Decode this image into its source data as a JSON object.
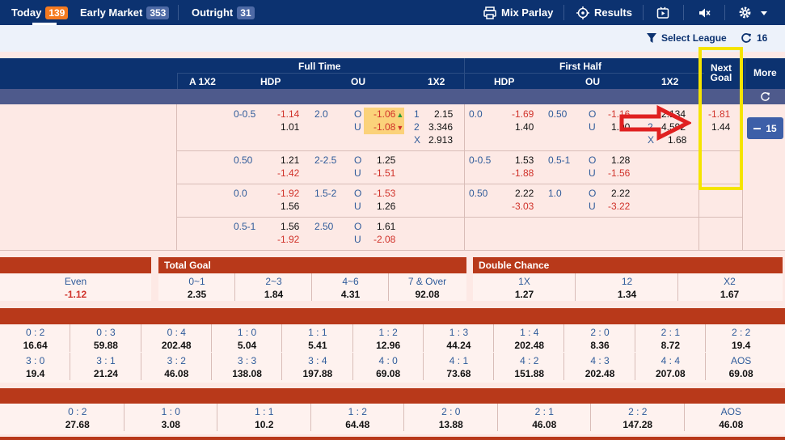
{
  "topnav": {
    "today": {
      "label": "Today",
      "count": "139"
    },
    "early": {
      "label": "Early Market",
      "count": "353"
    },
    "outright": {
      "label": "Outright",
      "count": "31"
    },
    "mix_parlay": "Mix Parlay",
    "results": "Results"
  },
  "subbar": {
    "select_league": "Select League",
    "refresh_count": "16"
  },
  "header": {
    "full_time": "Full Time",
    "first_half": "First Half",
    "next_goal": "Next Goal",
    "more": "More",
    "cols": {
      "a1x2": "A 1X2",
      "hdp": "HDP",
      "ou": "OU",
      "x12": "1X2",
      "hdp2": "HDP",
      "ou2": "OU",
      "x12b": "1X2"
    }
  },
  "more_count": "15",
  "rows": [
    {
      "ft_hdp_line": "0-0.5",
      "ft_hdp_a": "-1.14",
      "ft_hdp_b": "1.01",
      "ft_ou_line": "2.0",
      "ft_o": "O",
      "ft_o_v": "-1.06",
      "ft_u": "U",
      "ft_u_v": "-1.08",
      "x1": "1",
      "x1v": "2.15",
      "x2": "2",
      "x2v": "3.346",
      "xx": "X",
      "xxv": "2.913",
      "fh_hdp_line": "0.0",
      "fh_hdp_a": "-1.69",
      "fh_hdp_b": "1.40",
      "fh_ou_line": "0.50",
      "fh_o": "O",
      "fh_o_v": "-1.16",
      "fh_u": "U",
      "fh_u_v": "1.00",
      "fh1v": "2.134",
      "fh2": "2",
      "fh2v": "4.592",
      "fhx": "X",
      "fhxv": "1.68",
      "ng_a": "-1.81",
      "ng_b": "1.44"
    },
    {
      "ft_hdp_line": "0.50",
      "ft_hdp_a": "1.21",
      "ft_hdp_b": "-1.42",
      "ft_ou_line": "2-2.5",
      "ft_o": "O",
      "ft_o_v": "1.25",
      "ft_u": "U",
      "ft_u_v": "-1.51",
      "fh_hdp_line": "0-0.5",
      "fh_hdp_a": "1.53",
      "fh_hdp_b": "-1.88",
      "fh_ou_line": "0.5-1",
      "fh_o": "O",
      "fh_o_v": "1.28",
      "fh_u": "U",
      "fh_u_v": "-1.56"
    },
    {
      "ft_hdp_line": "0.0",
      "ft_hdp_a": "-1.92",
      "ft_hdp_b": "1.56",
      "ft_ou_line": "1.5-2",
      "ft_o": "O",
      "ft_o_v": "-1.53",
      "ft_u": "U",
      "ft_u_v": "1.26",
      "fh_hdp_line": "0.50",
      "fh_hdp_a": "2.22",
      "fh_hdp_b": "-3.03",
      "fh_ou_line": "1.0",
      "fh_o": "O",
      "fh_o_v": "2.22",
      "fh_u": "U",
      "fh_u_v": "-3.22"
    },
    {
      "ft_hdp_line": "0.5-1",
      "ft_hdp_a": "1.56",
      "ft_hdp_b": "-1.92",
      "ft_ou_line": "2.50",
      "ft_o": "O",
      "ft_o_v": "1.61",
      "ft_u": "U",
      "ft_u_v": "-2.08"
    }
  ],
  "markets": {
    "oddeven": {
      "label": "Even",
      "value": "-1.12"
    },
    "total_goal": {
      "title": "Total Goal",
      "items": [
        {
          "l": "0~1",
          "v": "2.35"
        },
        {
          "l": "2~3",
          "v": "1.84"
        },
        {
          "l": "4~6",
          "v": "4.31"
        },
        {
          "l": "7 & Over",
          "v": "92.08"
        }
      ]
    },
    "double_chance": {
      "title": "Double Chance",
      "items": [
        {
          "l": "1X",
          "v": "1.27"
        },
        {
          "l": "12",
          "v": "1.34"
        },
        {
          "l": "X2",
          "v": "1.67"
        }
      ]
    },
    "cs_row1": [
      {
        "l": "0 : 2",
        "v": "16.64"
      },
      {
        "l": "0 : 3",
        "v": "59.88"
      },
      {
        "l": "0 : 4",
        "v": "202.48"
      },
      {
        "l": "1 : 0",
        "v": "5.04"
      },
      {
        "l": "1 : 1",
        "v": "5.41"
      },
      {
        "l": "1 : 2",
        "v": "12.96"
      },
      {
        "l": "1 : 3",
        "v": "44.24"
      },
      {
        "l": "1 : 4",
        "v": "202.48"
      },
      {
        "l": "2 : 0",
        "v": "8.36"
      },
      {
        "l": "2 : 1",
        "v": "8.72"
      },
      {
        "l": "2 : 2",
        "v": "19.4"
      }
    ],
    "cs_row2": [
      {
        "l": "3 : 0",
        "v": "19.4"
      },
      {
        "l": "3 : 1",
        "v": "21.24"
      },
      {
        "l": "3 : 2",
        "v": "46.08"
      },
      {
        "l": "3 : 3",
        "v": "138.08"
      },
      {
        "l": "3 : 4",
        "v": "197.88"
      },
      {
        "l": "4 : 0",
        "v": "69.08"
      },
      {
        "l": "4 : 1",
        "v": "73.68"
      },
      {
        "l": "4 : 2",
        "v": "151.88"
      },
      {
        "l": "4 : 3",
        "v": "202.48"
      },
      {
        "l": "4 : 4",
        "v": "207.08"
      },
      {
        "l": "AOS",
        "v": "69.08"
      }
    ],
    "cs_fh": [
      {
        "l": "0 : 2",
        "v": "27.68"
      },
      {
        "l": "1 : 0",
        "v": "3.08"
      },
      {
        "l": "1 : 1",
        "v": "10.2"
      },
      {
        "l": "1 : 2",
        "v": "64.48"
      },
      {
        "l": "2 : 0",
        "v": "13.88"
      },
      {
        "l": "2 : 1",
        "v": "46.08"
      },
      {
        "l": "2 : 2",
        "v": "147.28"
      },
      {
        "l": "AOS",
        "v": "46.08"
      }
    ]
  },
  "colors": {
    "nav": "#0c3270",
    "accent_orange": "#f47a20",
    "market_red": "#b8391a",
    "highlight_yellow": "#f5e400",
    "arrow_red": "#e02020"
  }
}
